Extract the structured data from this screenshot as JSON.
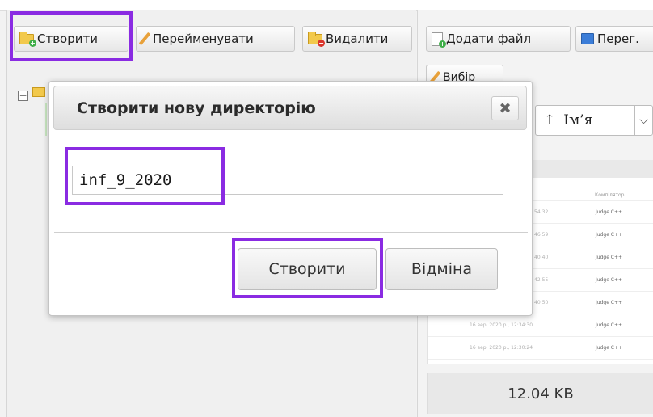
{
  "toolbar": {
    "create_label": "Створити",
    "rename_label": "Перейменувати",
    "delete_label": "Видалити",
    "add_file_label": "Додати файл",
    "view_label": "Перег."
  },
  "right_panel": {
    "partial_button_label": "Вибір",
    "sort": {
      "arrow": "↑",
      "field": "Ім’я",
      "chevron": "⌵"
    },
    "column_header": "Компілятор",
    "rows": [
      {
        "date": "54:32",
        "compiler": "Judge C++"
      },
      {
        "date": "46:59",
        "compiler": "Judge C++"
      },
      {
        "date": "40:40",
        "compiler": "Judge C++"
      },
      {
        "date": "42:55",
        "compiler": "Judge C++"
      },
      {
        "date": "40:50",
        "compiler": "Judge C++"
      },
      {
        "date": "16 вер. 2020 р., 12:34:30",
        "compiler": "Judge C++"
      },
      {
        "date": "16 вер. 2020 р., 12:30:24",
        "compiler": "Judge C++"
      }
    ],
    "file_size": "12.04 KB"
  },
  "tree": {
    "toggle": "−"
  },
  "dialog": {
    "title": "Створити нову директорію",
    "close_glyph": "✖",
    "input_value": "inf_9_2020",
    "create_button": "Створити",
    "cancel_button": "Відміна"
  },
  "colors": {
    "highlight": "#8a2be2",
    "folder": "#f2c94c"
  }
}
